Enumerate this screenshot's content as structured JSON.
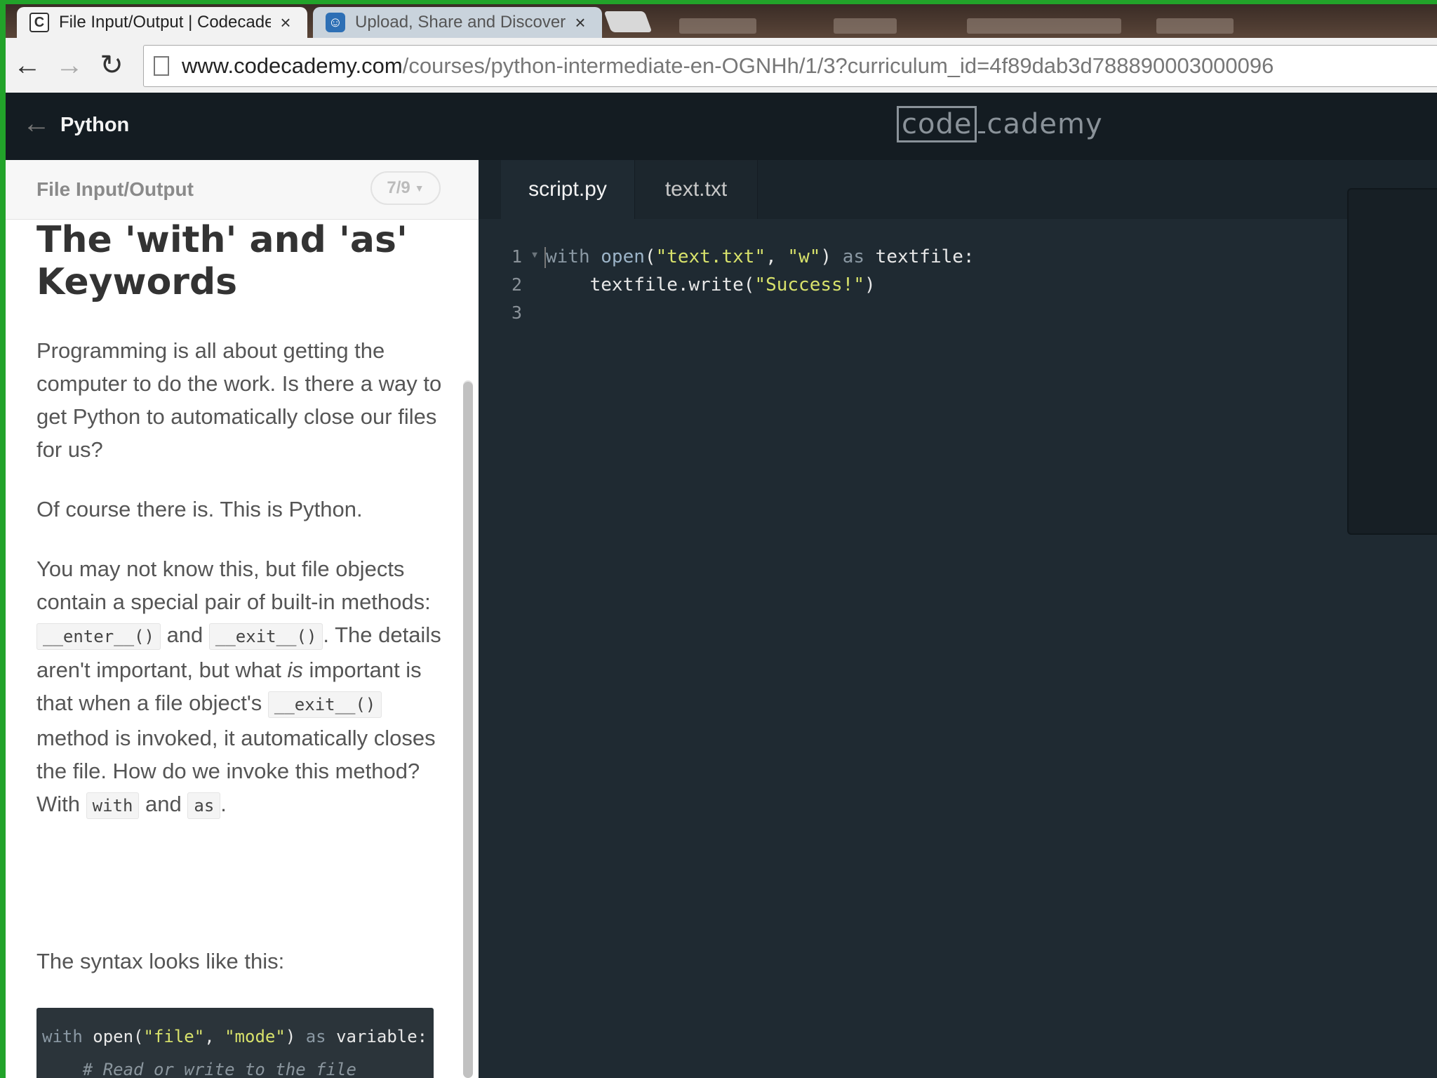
{
  "browser": {
    "tabs": [
      {
        "title": "File Input/Output | Codecademy",
        "favicon": "codecademy-favicon",
        "active": true
      },
      {
        "title": "Upload, Share and Discover",
        "favicon": "upload-share-favicon",
        "active": false
      }
    ],
    "url_host": "www.codecademy.com",
    "url_path": "/courses/python-intermediate-en-OGNHh/1/3?curriculum_id=4f89dab3d788890003000096"
  },
  "header": {
    "course": "Python",
    "logo_part1": "code",
    "logo_part2": "cademy"
  },
  "lesson": {
    "section": "File Input/Output",
    "progress": "7/9",
    "title": "The 'with' and 'as' Keywords",
    "p1": "Programming is all about getting the computer to do the work. Is there a way to get Python to automatically close our files for us?",
    "p2": "Of course there is. This is Python.",
    "p3": {
      "t1": "You may not know this, but file objects contain a special pair of built-in methods: ",
      "c1": "__enter__()",
      "t2": " and ",
      "c2": "__exit__()",
      "t3": ". The details aren't important, but what ",
      "em": "is",
      "t4": " important is that when a file object's ",
      "c3": "__exit__()",
      "t5": " method is invoked, it automatically closes the file. How do we invoke this method? With ",
      "c4": "with",
      "t6": " and ",
      "c5": "as",
      "t7": "."
    },
    "p4": "The syntax looks like this:",
    "example": {
      "l1_kw1": "with",
      "l1_fn": "open",
      "l1_p1": "(",
      "l1_s1": "\"file\"",
      "l1_comma": ", ",
      "l1_s2": "\"mode\"",
      "l1_p2": ")",
      "l1_kw2": "as",
      "l1_var": "variable:",
      "l2_comment": "# Read or write to the file"
    }
  },
  "editor": {
    "tabs": [
      "script.py",
      "text.txt"
    ],
    "line_numbers": [
      "1",
      "2",
      "3"
    ],
    "code": {
      "l1_kw1": "with",
      "l1_fn": "open",
      "l1_p1": "(",
      "l1_s1": "\"text.txt\"",
      "l1_comma": ", ",
      "l1_s2": "\"w\"",
      "l1_p2": ")",
      "l1_kw2": "as",
      "l1_var": "textfile:",
      "l2_call": "textfile.write(",
      "l2_str": "\"Success!\"",
      "l2_close": ")"
    }
  },
  "colors": {
    "border_green": "#22a32a",
    "editor_bg": "#1f2a32",
    "header_bg": "#141c22",
    "string": "#d8e26b"
  }
}
